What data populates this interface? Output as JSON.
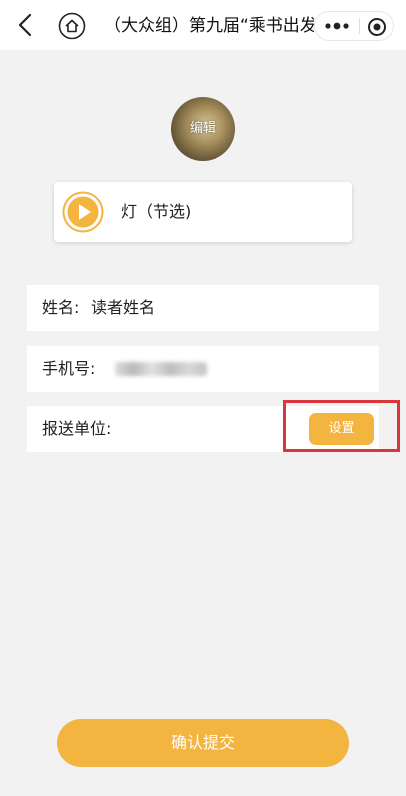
{
  "navbar": {
    "title": "（大众组）第九届“乘书出发  通过…",
    "back_icon": "chevron-left-icon",
    "home_icon": "home-icon",
    "more_icon": "more-dots-icon",
    "target_icon": "target-icon"
  },
  "avatar": {
    "label": "编辑"
  },
  "audio": {
    "title": "灯（节选)",
    "icon": "play-icon",
    "accent": "#f3b440"
  },
  "form": {
    "name_label": "姓名:",
    "name_value": "读者姓名",
    "phone_label": "手机号:",
    "unit_label": "报送单位:",
    "set_button_label": "设置"
  },
  "submit": {
    "label": "确认提交"
  },
  "colors": {
    "accent": "#f3b440",
    "highlight": "#d9363e",
    "background": "#f2f2f2"
  }
}
